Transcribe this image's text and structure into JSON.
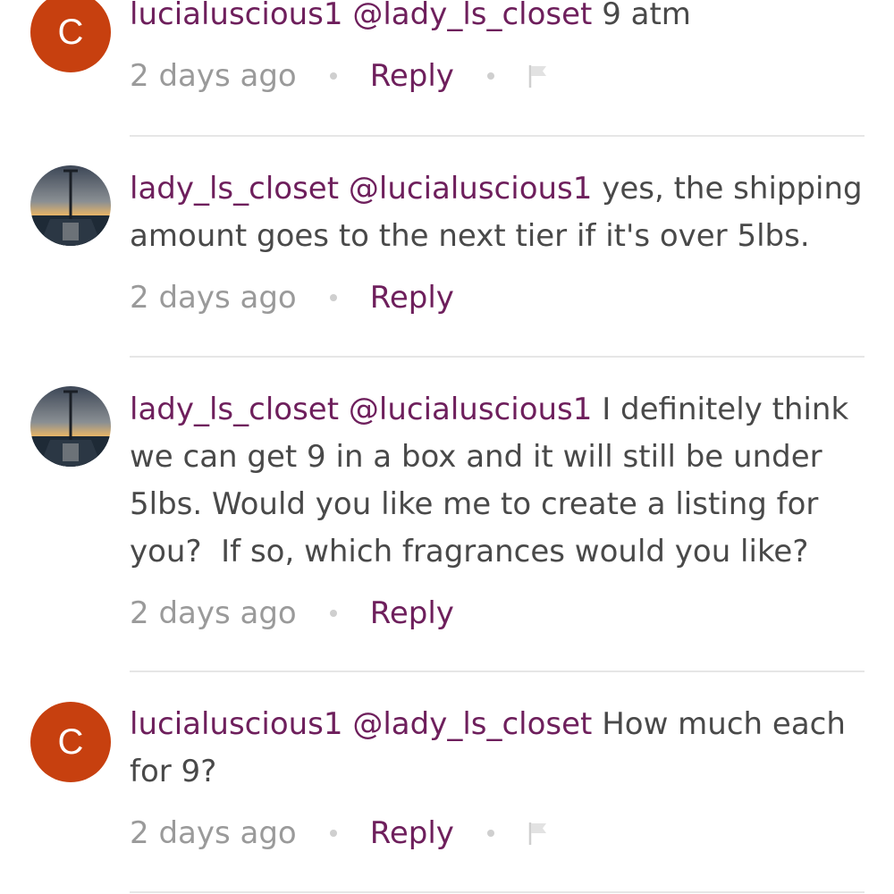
{
  "comments": [
    {
      "author": "lucialuscious1",
      "mention": "@lady_ls_closet",
      "text": "9 atm",
      "time": "2 days ago",
      "reply_label": "Reply",
      "avatar_letter": "C",
      "avatar_type": "letter",
      "has_flag": true,
      "flag_icon": "flag-icon"
    },
    {
      "author": "lady_ls_closet",
      "mention": "@lucialuscious1",
      "text": "yes, the shipping amount goes to the next tier if it's over 5lbs.",
      "time": "2 days ago",
      "reply_label": "Reply",
      "avatar_type": "photo",
      "has_flag": false
    },
    {
      "author": "lady_ls_closet",
      "mention": "@lucialuscious1",
      "text": "I definitely think we can get 9 in a box and it will still be under 5lbs. Would you like me to create a listing for you?  If so, which fragrances would you like?",
      "time": "2 days ago",
      "reply_label": "Reply",
      "avatar_type": "photo",
      "has_flag": false
    },
    {
      "author": "lucialuscious1",
      "mention": "@lady_ls_closet",
      "text": "How much each for 9?",
      "time": "2 days ago",
      "reply_label": "Reply",
      "avatar_letter": "C",
      "avatar_type": "letter",
      "has_flag": true,
      "flag_icon": "flag-icon"
    }
  ],
  "colors": {
    "accent": "#6e1f5c",
    "avatar_letter_bg": "#c7400f",
    "text": "#494949",
    "muted": "#9a9a9a"
  }
}
